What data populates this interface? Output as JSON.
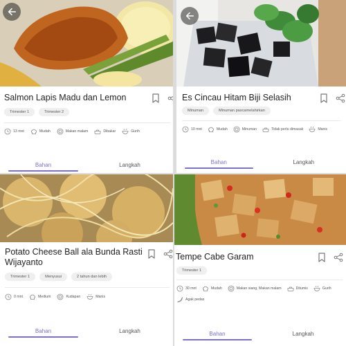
{
  "recipes": [
    {
      "title": "Salmon Lapis Madu dan Lemon",
      "tags": [
        "Trimester 1",
        "Trimester 2"
      ],
      "meta": [
        {
          "icon": "clock-icon",
          "text": "13 mnt"
        },
        {
          "icon": "chef-hat-icon",
          "text": "Mudah"
        },
        {
          "icon": "plate-icon",
          "text": "Makan malam"
        },
        {
          "icon": "pan-icon",
          "text": "Dibakar"
        },
        {
          "icon": "bowl-icon",
          "text": "Gurih"
        }
      ],
      "tabs": {
        "ingredients": "Bahan",
        "steps": "Langkah"
      }
    },
    {
      "title": "Es Cincau Hitam Biji Selasih",
      "tags": [
        "Minuman",
        "Minuman pascamelahirkan"
      ],
      "meta": [
        {
          "icon": "clock-icon",
          "text": "10 mnt"
        },
        {
          "icon": "chef-hat-icon",
          "text": "Mudah"
        },
        {
          "icon": "plate-icon",
          "text": "Minuman"
        },
        {
          "icon": "pan-icon",
          "text": "Tidak perlu dimasak"
        },
        {
          "icon": "bowl-icon",
          "text": "Manis"
        }
      ],
      "tabs": {
        "ingredients": "Bahan",
        "steps": "Langkah"
      }
    },
    {
      "title": "Potato Cheese Ball ala Bunda Rasti Wijayanto",
      "tags": [
        "Trimester 1",
        "Menyusui",
        "2 tahun dan lebih"
      ],
      "meta": [
        {
          "icon": "clock-icon",
          "text": "0 mnt"
        },
        {
          "icon": "chef-hat-icon",
          "text": "Medium"
        },
        {
          "icon": "plate-icon",
          "text": "Kudapan"
        },
        {
          "icon": "bowl-icon",
          "text": "Manis"
        }
      ],
      "tabs": {
        "ingredients": "Bahan",
        "steps": "Langkah"
      }
    },
    {
      "title": "Tempe Cabe Garam",
      "tags": [
        "Trimester 1"
      ],
      "meta": [
        {
          "icon": "clock-icon",
          "text": "30 mnt"
        },
        {
          "icon": "chef-hat-icon",
          "text": "Mudah"
        },
        {
          "icon": "plate-icon",
          "text": "Makan siang, Makan malam"
        },
        {
          "icon": "pan-icon",
          "text": "Ditumis"
        },
        {
          "icon": "bowl-icon",
          "text": "Gurih"
        },
        {
          "icon": "chili-icon",
          "text": "Agak pedas"
        }
      ],
      "tabs": {
        "ingredients": "Bahan",
        "steps": "Langkah"
      }
    }
  ],
  "colors": {
    "accent": "#7b6fd1",
    "text": "#222222",
    "muted": "#555555",
    "tag_bg": "#efefef"
  }
}
